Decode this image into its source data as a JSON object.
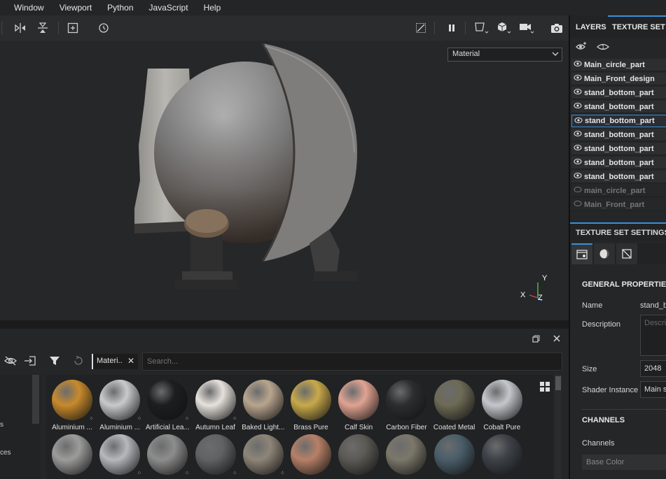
{
  "menu": [
    "Window",
    "Viewport",
    "Python",
    "JavaScript",
    "Help"
  ],
  "viewport": {
    "channel_select": "Material",
    "axis_labels": {
      "x": "X",
      "y": "Y",
      "z": "Z"
    }
  },
  "shelf": {
    "filter_chip": "Materi..",
    "search_placeholder": "Search...",
    "left_text": [
      "s",
      "ces"
    ],
    "materials_row1": [
      {
        "name": "Aluminium ...",
        "color": "#c88a2c",
        "dots": true
      },
      {
        "name": "Aluminium ...",
        "color": "#c9cacb",
        "dots": true
      },
      {
        "name": "Artificial Lea...",
        "color": "#1d1e1f",
        "dots": true
      },
      {
        "name": "Autumn Leaf",
        "color": "#e5e1dc",
        "dots": true
      },
      {
        "name": "Baked Light...",
        "color": "#b8a58e",
        "dots": false
      },
      {
        "name": "Brass Pure",
        "color": "#c8a94a",
        "dots": false
      },
      {
        "name": "Calf Skin",
        "color": "#e0a392",
        "dots": false
      },
      {
        "name": "Carbon Fiber",
        "color": "#2c2d2f",
        "dots": false
      },
      {
        "name": "Coated Metal",
        "color": "#6d6a55",
        "dots": false
      },
      {
        "name": "Cobalt Pure",
        "color": "#c4c7cc",
        "dots": false
      }
    ],
    "materials_row2": [
      {
        "color": "#9c9c9b",
        "dots": false
      },
      {
        "color": "#b5b9bc",
        "dots": true
      },
      {
        "color": "#8c8d8c",
        "dots": true
      },
      {
        "color": "#606264",
        "dots": true
      },
      {
        "color": "#8e8578",
        "dots": true
      },
      {
        "color": "#b78067",
        "dots": false
      },
      {
        "color": "#5c5a55",
        "dots": false
      },
      {
        "color": "#7b786a",
        "dots": false
      },
      {
        "color": "#4a5e6a",
        "dots": false
      },
      {
        "color": "#3d4248",
        "dots": false
      }
    ]
  },
  "right_panel": {
    "tabs": [
      "LAYERS",
      "TEXTURE SET L"
    ],
    "layers": [
      {
        "name": "Main_circle_part",
        "state": "normal"
      },
      {
        "name": "Main_Front_design",
        "state": "normal"
      },
      {
        "name": "stand_bottom_part",
        "state": "normal"
      },
      {
        "name": "stand_bottom_part",
        "state": "normal"
      },
      {
        "name": "stand_bottom_part",
        "state": "selected"
      },
      {
        "name": "stand_bottom_part",
        "state": "normal"
      },
      {
        "name": "stand_bottom_part",
        "state": "normal"
      },
      {
        "name": "stand_bottom_part",
        "state": "normal"
      },
      {
        "name": "stand_bottom_part",
        "state": "normal"
      },
      {
        "name": "main_circle_part",
        "state": "hidden"
      },
      {
        "name": "Main_Front_part",
        "state": "hidden"
      }
    ],
    "texture_set_settings": "TEXTURE SET SETTINGS",
    "general_properties": "GENERAL PROPERTIES",
    "name_label": "Name",
    "name_value": "stand_b",
    "description_label": "Description",
    "description_placeholder": "Descri",
    "size_label": "Size",
    "size_value": "2048",
    "shader_label": "Shader Instance",
    "shader_value": "Main s",
    "channels_title": "CHANNELS",
    "channels_label": "Channels",
    "base_color": "Base Color"
  }
}
